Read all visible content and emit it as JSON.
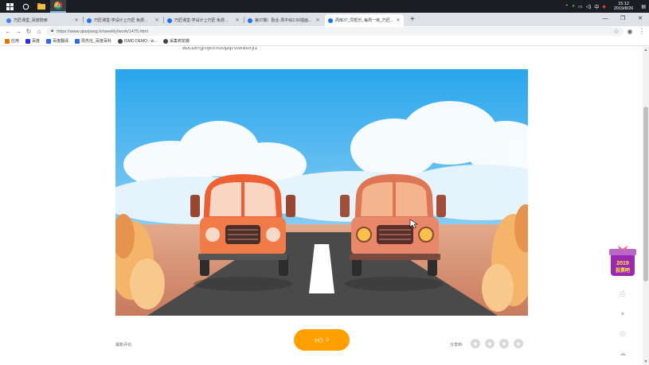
{
  "taskbar": {
    "tray": {
      "lang": "中",
      "time": "15:12",
      "date": "2019/8/26"
    }
  },
  "browser": {
    "tabs": [
      {
        "title": "巧匠课堂_百度搜索",
        "color": "#3b82f6"
      },
      {
        "title": "巧匠课堂-学设计上巧匠 免费...",
        "color": "#1a73e8"
      },
      {
        "title": "巧匠课堂-学设计上巧匠 免费...",
        "color": "#1a73e8"
      },
      {
        "title": "第37期：励业·周平绘2.50插画...",
        "color": "#1a73e8"
      },
      {
        "title": "周练37_同框乐_每周一练_巧匠...",
        "color": "#1a73e8"
      }
    ],
    "url": "https://www.qiaojiang.tv/weekly/work/1475.html",
    "bookmarks": [
      {
        "label": "应用",
        "color": "#e37400"
      },
      {
        "label": "百度",
        "color": "#2932e1"
      },
      {
        "label": "百度翻译",
        "color": "#2d6be4"
      },
      {
        "label": "周杰伦_百度百科",
        "color": "#2d6be4"
      },
      {
        "label": "ISMO DEMO - w...",
        "color": "#444444"
      },
      {
        "label": "采集到花瓣",
        "color": "#444444"
      }
    ]
  },
  "page": {
    "partial_text": "abcdefghijklmoopqrstwauxyz",
    "like_count": "0",
    "recent_label": "最新评论:",
    "share_label": "分享到:",
    "promo_text": "2019 投票吧"
  },
  "colors": {
    "accent": "#ffa000",
    "sky_top": "#29a6ec",
    "road": "#4a4a4a"
  }
}
